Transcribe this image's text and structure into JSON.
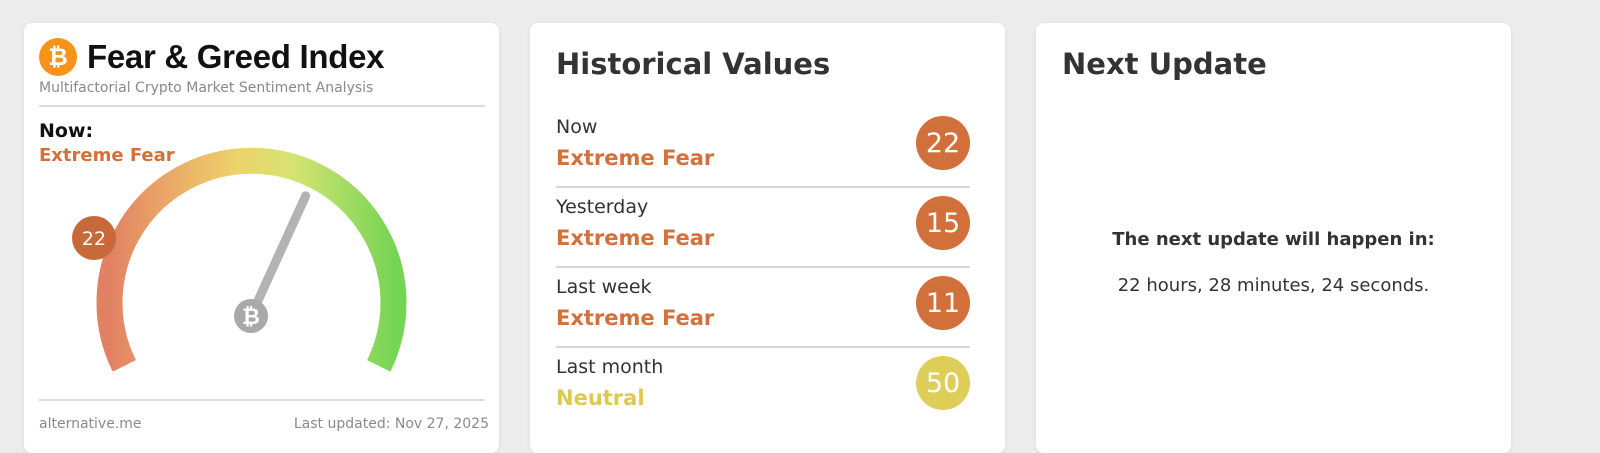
{
  "fg_card": {
    "logo_glyph": "₿",
    "title": "Fear & Greed Index",
    "subtitle": "Multifactorial Crypto Market Sentiment Analysis",
    "now_label": "Now:",
    "now_classification": "Extreme Fear",
    "gauge_value": "22",
    "gauge_value_fraction": 0.22,
    "center_glyph": "₿",
    "source": "alternative.me",
    "last_updated": "Last updated: Nov 27, 2025",
    "colors": {
      "extreme_fear": "#d4703a",
      "fear": "#e4a558",
      "neutral": "#e0cf5c",
      "greed": "#9ad65e",
      "extreme_greed": "#6fcf4a"
    }
  },
  "history": {
    "title": "Historical Values",
    "rows": [
      {
        "period": "Now",
        "classification": "Extreme Fear",
        "value": "22",
        "color": "#d4703a"
      },
      {
        "period": "Yesterday",
        "classification": "Extreme Fear",
        "value": "15",
        "color": "#d4703a"
      },
      {
        "period": "Last week",
        "classification": "Extreme Fear",
        "value": "11",
        "color": "#d4703a"
      },
      {
        "period": "Last month",
        "classification": "Neutral",
        "value": "50",
        "color": "#dfcd5a"
      }
    ]
  },
  "next_update": {
    "title": "Next Update",
    "label": "The next update will happen in:",
    "countdown": "22 hours, 28 minutes, 24 seconds."
  }
}
